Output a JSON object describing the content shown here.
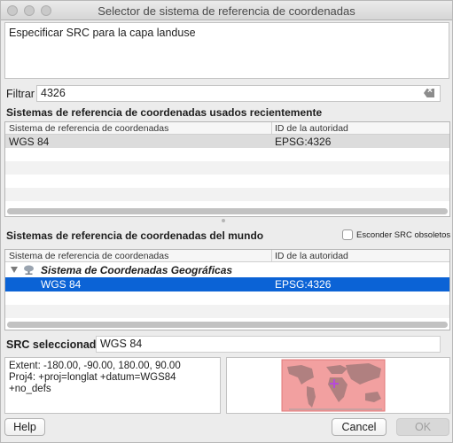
{
  "window": {
    "title": "Selector de sistema de referencia de coordenadas"
  },
  "description": "Especificar SRC para la capa landuse",
  "filter": {
    "label": "Filtrar",
    "value": "4326"
  },
  "recent": {
    "title": "Sistemas de referencia de coordenadas usados recientemente",
    "columns": [
      "Sistema de referencia de coordenadas",
      "ID de la autoridad"
    ],
    "rows": [
      {
        "name": "WGS 84",
        "authority": "EPSG:4326"
      }
    ]
  },
  "world": {
    "title": "Sistemas de referencia de coordenadas del mundo",
    "hide_deprecated_label": "Esconder SRC obsoletos",
    "hide_deprecated_checked": false,
    "columns": [
      "Sistema de referencia de coordenadas",
      "ID de la autoridad"
    ],
    "group": {
      "name": "Sistema de Coordenadas Geográficas"
    },
    "rows": [
      {
        "name": "WGS 84",
        "authority": "EPSG:4326",
        "selected": true
      }
    ]
  },
  "selected": {
    "label": "SRC seleccionado",
    "value": "WGS 84"
  },
  "extent": {
    "line1": "Extent: -180.00, -90.00, 180.00, 90.00",
    "line2": "Proj4: +proj=longlat +datum=WGS84",
    "line3": "+no_defs"
  },
  "buttons": {
    "help": "Help",
    "cancel": "Cancel",
    "ok": "OK"
  },
  "colors": {
    "selection": "#0b63d6",
    "map_overlay": "#f2a0a0",
    "marker": "#b64ad8"
  }
}
